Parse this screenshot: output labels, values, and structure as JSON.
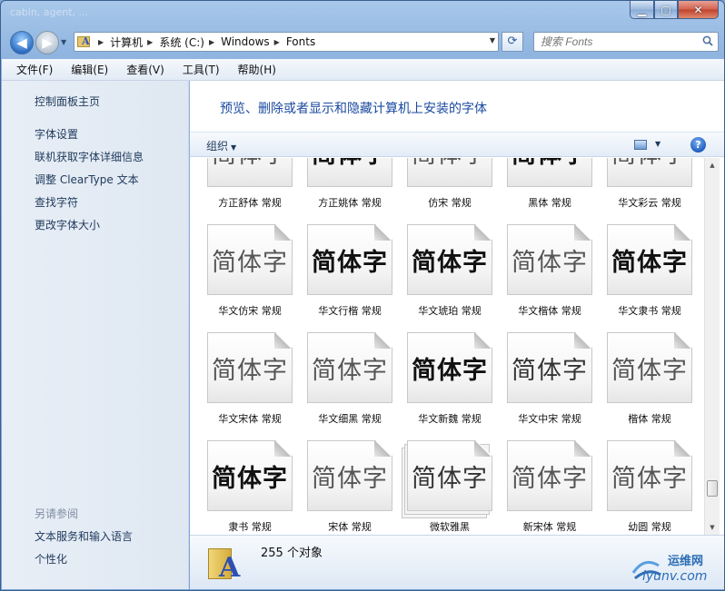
{
  "window": {
    "title": "cabin, agent, ...",
    "min_glyph": "▁",
    "max_glyph": "▢",
    "close_glyph": "✕"
  },
  "nav": {
    "back_glyph": "◀",
    "forward_glyph": "▶",
    "dropdown_glyph": "▼",
    "breadcrumbs": [
      "计算机",
      "系统 (C:)",
      "Windows",
      "Fonts"
    ],
    "crumb_sep": "▶",
    "refresh_glyph": "⟳",
    "search_placeholder": "搜索 Fonts"
  },
  "menu": [
    "文件(F)",
    "编辑(E)",
    "查看(V)",
    "工具(T)",
    "帮助(H)"
  ],
  "sidebar": {
    "links": [
      "控制面板主页",
      "字体设置",
      "联机获取字体详细信息",
      "调整 ClearType 文本",
      "查找字符",
      "更改字体大小"
    ],
    "see_also": "另请参阅",
    "bottom_links": [
      "文本服务和输入语言",
      "个性化"
    ]
  },
  "main": {
    "heading": "预览、删除或者显示和隐藏计算机上安装的字体",
    "organize": "组织",
    "dropdown_glyph": "▼",
    "help_glyph": "?"
  },
  "fonts": {
    "sample_text": "简体字",
    "rows": [
      [
        {
          "label": "方正舒体 常规",
          "style": "light"
        },
        {
          "label": "方正姚体 常规",
          "style": "bold"
        },
        {
          "label": "仿宋 常规",
          "style": "light"
        },
        {
          "label": "黑体 常规",
          "style": "bold"
        },
        {
          "label": "华文彩云 常规",
          "style": "light"
        }
      ],
      [
        {
          "label": "华文仿宋 常规",
          "style": "light"
        },
        {
          "label": "华文行楷 常规",
          "style": "bold"
        },
        {
          "label": "华文琥珀 常规",
          "style": "bold"
        },
        {
          "label": "华文楷体 常规",
          "style": "light"
        },
        {
          "label": "华文隶书 常规",
          "style": "bold"
        }
      ],
      [
        {
          "label": "华文宋体 常规",
          "style": "light"
        },
        {
          "label": "华文细黑 常规",
          "style": "light"
        },
        {
          "label": "华文新魏 常规",
          "style": "bold"
        },
        {
          "label": "华文中宋 常规",
          "style": "serif"
        },
        {
          "label": "楷体 常规",
          "style": "light"
        }
      ],
      [
        {
          "label": "隶书 常规",
          "style": "bold"
        },
        {
          "label": "宋体 常规",
          "style": "light"
        },
        {
          "label": "微软雅黑",
          "style": "stack"
        },
        {
          "label": "新宋体 常规",
          "style": "light"
        },
        {
          "label": "幼圆 常规",
          "style": "light"
        }
      ]
    ]
  },
  "scrollbar": {
    "up_glyph": "▲",
    "down_glyph": "▼",
    "position": 0.93
  },
  "status": {
    "count_text": "255 个对象"
  },
  "watermark": {
    "name": "运维网",
    "url": "iyunv.com"
  }
}
